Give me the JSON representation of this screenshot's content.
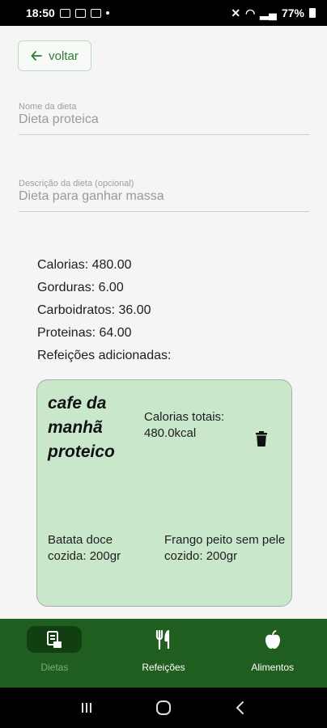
{
  "status_bar": {
    "time": "18:50",
    "battery": "77%"
  },
  "back_button": {
    "label": "voltar"
  },
  "diet_name": {
    "label": "Nome da dieta",
    "value": "Dieta proteica"
  },
  "diet_description": {
    "label": "Descrição da dieta (opcional)",
    "value": "Dieta para ganhar massa"
  },
  "summary": {
    "calories": "Calorias: 480.00",
    "fats": "Gorduras: 6.00",
    "carbs": "Carboidratos: 36.00",
    "proteins": "Proteinas: 64.00",
    "meals_added": "Refeições adicionadas:"
  },
  "meal_card": {
    "title": "cafe da manhã proteico",
    "total_calories_label": "Calorias totais:",
    "total_calories_value": "480.0kcal",
    "foods": [
      "Batata doce cozida: 200gr",
      "Frango peito sem pele cozido: 200gr"
    ]
  },
  "bottom_nav": {
    "items": [
      {
        "label": "Dietas",
        "icon": "diet-list-icon",
        "active": true
      },
      {
        "label": "Refeições",
        "icon": "fork-knife-icon",
        "active": false
      },
      {
        "label": "Alimentos",
        "icon": "apple-icon",
        "active": false
      }
    ]
  },
  "colors": {
    "accent": "#2e7d32",
    "nav_bg": "#1f5e1f",
    "card_bg": "#c9e7cb"
  }
}
